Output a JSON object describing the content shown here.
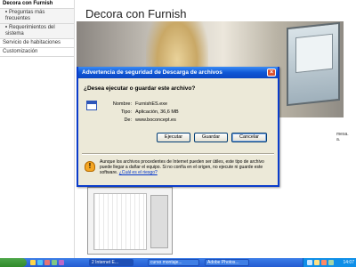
{
  "sidebar": {
    "items": [
      {
        "label": "Decora con Furnish"
      },
      {
        "label": "Preguntas más frecuentes"
      },
      {
        "label": "Requerimientos del sistema"
      },
      {
        "label": "Servicio de habitaciones"
      },
      {
        "label": "Customización"
      }
    ]
  },
  "main": {
    "title": "Decora con Furnish",
    "side_text_1": "mesa.",
    "side_text_2": "a."
  },
  "dialog": {
    "title": "Advertencia de seguridad de Descarga de archivos",
    "question": "¿Desea ejecutar o guardar este archivo?",
    "name_label": "Nombre:",
    "name_value": "FurnishES.exe",
    "type_label": "Tipo:",
    "type_value": "Aplicación, 36,6 MB",
    "from_label": "De:",
    "from_value": "www.boconcept.es",
    "buttons": {
      "run": "Ejecutar",
      "save": "Guardar",
      "cancel": "Cancelar"
    },
    "warning_text": "Aunque los archivos procedentes de Internet pueden ser útiles, este tipo de archivo puede llegar a dañar el equipo. Si no confía en el origen, no ejecute ni guarde este software.",
    "warning_link": "¿Cuál es el riesgo?"
  },
  "taskbar": {
    "tasks": [
      "2 Internet E...",
      "curso montaje...",
      "Adobe Photos..."
    ],
    "clock": "14:07"
  }
}
